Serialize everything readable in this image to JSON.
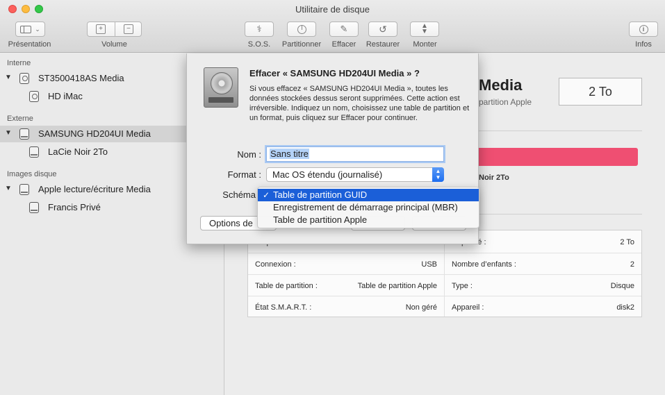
{
  "window": {
    "title": "Utilitaire de disque"
  },
  "toolbar": {
    "presentation": "Présentation",
    "volume": "Volume",
    "sos": "S.O.S.",
    "partitionner": "Partitionner",
    "effacer": "Effacer",
    "restaurer": "Restaurer",
    "monter": "Monter",
    "infos": "Infos"
  },
  "sidebar": {
    "sections": [
      {
        "label": "Interne"
      },
      {
        "label": "Externe"
      },
      {
        "label": "Images disque"
      }
    ],
    "items": [
      {
        "label": "ST3500418AS Media"
      },
      {
        "label": "HD iMac"
      },
      {
        "label": "SAMSUNG HD204UI Media"
      },
      {
        "label": "LaCie Noir 2To"
      },
      {
        "label": "Apple lecture/écriture Media"
      },
      {
        "label": "Francis Privé"
      }
    ]
  },
  "main": {
    "disk_name_tail": "Media",
    "disk_sub_tail": "partition Apple",
    "capacity": "2 To",
    "usage_legend": "Noir 2To",
    "info": {
      "left": [
        {
          "k": "Emplacement :",
          "v": "Externe"
        },
        {
          "k": "Connexion :",
          "v": "USB"
        },
        {
          "k": "Table de partition :",
          "v": "Table de partition Apple"
        },
        {
          "k": "État S.M.A.R.T. :",
          "v": "Non géré"
        }
      ],
      "right": [
        {
          "k": "Capacité :",
          "v": "2 To"
        },
        {
          "k": "Nombre d’enfants :",
          "v": "2"
        },
        {
          "k": "Type :",
          "v": "Disque"
        },
        {
          "k": "Appareil :",
          "v": "disk2"
        }
      ]
    }
  },
  "dialog": {
    "title": "Effacer « SAMSUNG HD204UI Media » ?",
    "body": "Si vous effacez « SAMSUNG HD204UI Media », toutes les données stockées dessus seront supprimées. Cette action est irréversible. Indiquez un nom, choisissez une table de partition et un format, puis cliquez sur Effacer pour continuer.",
    "name_label": "Nom :",
    "name_value": "Sans titre",
    "format_label": "Format :",
    "format_value": "Mac OS étendu (journalisé)",
    "scheme_label": "Schéma",
    "options_button": "Options de"
  },
  "scheme_menu": {
    "items": [
      {
        "label": "Table de partition GUID",
        "selected": true
      },
      {
        "label": "Enregistrement de démarrage principal (MBR)",
        "selected": false
      },
      {
        "label": "Table de partition Apple",
        "selected": false
      }
    ]
  },
  "colors": {
    "selection": "#1b5fd8",
    "usage_bar": "#ef4f72",
    "popup_arrows": "#1e6ef0"
  }
}
